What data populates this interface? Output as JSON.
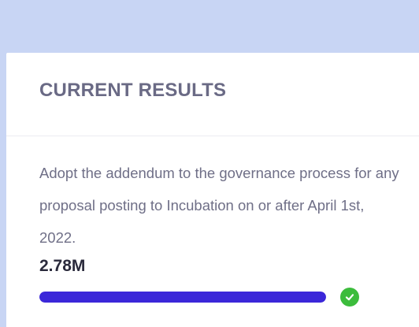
{
  "card": {
    "title": "CURRENT RESULTS",
    "proposal_text": "Adopt the addendum to the governance process for any proposal posting to Incubation on or after April 1st, 2022.",
    "vote_total": "2.78M",
    "progress_fraction": 1.0,
    "status_icon": "check-circle-icon"
  },
  "colors": {
    "page_background": "#c8d5f4",
    "card_background": "#ffffff",
    "title": "#6a6a85",
    "body_text": "#6f6f87",
    "value_text": "#2a2a3c",
    "progress_fill": "#3b27d9",
    "success": "#3cbc3c"
  }
}
